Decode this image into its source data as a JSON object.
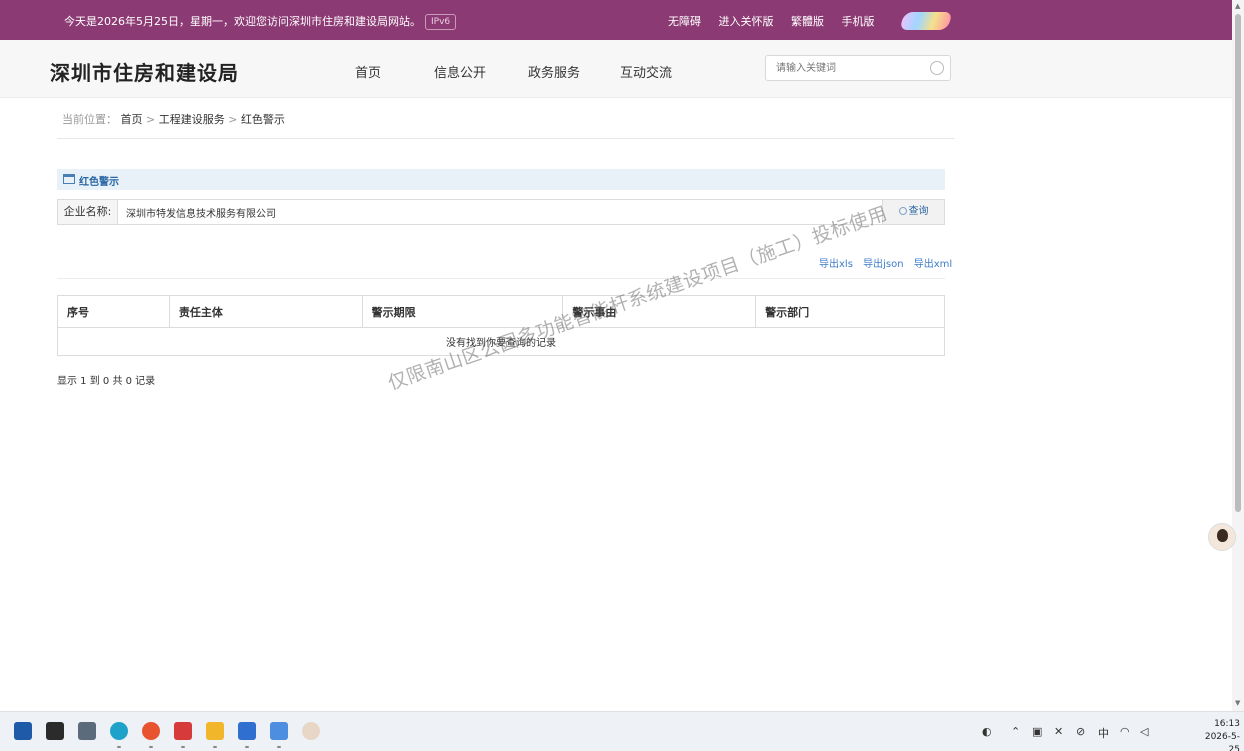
{
  "topbar": {
    "greeting": "今天是2026年5月25日，星期一，欢迎您访问深圳市住房和建设局网站。",
    "ipv6": "IPv6",
    "links": [
      "无障碍",
      "进入关怀版",
      "繁體版",
      "手机版"
    ]
  },
  "header": {
    "site_title": "深圳市住房和建设局",
    "nav": [
      "首页",
      "信息公开",
      "政务服务",
      "互动交流"
    ],
    "search_placeholder": "请输入关键词"
  },
  "breadcrumb": {
    "prefix": "当前位置：",
    "items": [
      "首页",
      "工程建设服务",
      "红色警示"
    ],
    "separator": ">"
  },
  "panel": {
    "title": "红色警示",
    "filter_label": "企业名称:",
    "filter_value": "深圳市特发信息技术服务有限公司",
    "query_button": "查询",
    "exports": [
      "导出xls",
      "导出json",
      "导出xml"
    ]
  },
  "table": {
    "columns": [
      "序号",
      "责任主体",
      "警示期限",
      "警示事由",
      "警示部门"
    ],
    "empty_message": "没有找到你要查询的记录"
  },
  "summary": "显示 1 到 0 共 0 记录",
  "watermark": "仅限南山区公园多功能智能杆系统建设项目（施工）投标使用",
  "taskbar": {
    "time": "16:13",
    "date": "2026-5-25"
  }
}
